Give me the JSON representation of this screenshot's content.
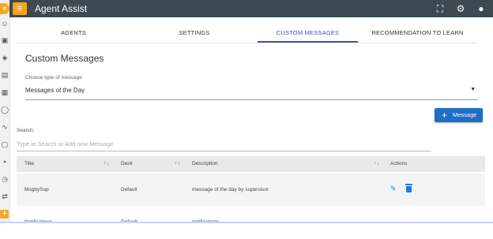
{
  "app": {
    "title": "Agent Assist",
    "accent": "#f5a623",
    "topbar_color": "#3c4a51",
    "primary": "#1f6fc6"
  },
  "header_icons": [
    "fullscreen-icon",
    "gear-icon",
    "account-icon"
  ],
  "sidebar_icons": [
    "smiley-icon",
    "contact-card-icon",
    "paint-bucket-icon",
    "chat-icon",
    "calendar-icon",
    "help-circle-icon",
    "activity-icon",
    "clipboard-icon",
    "grid-icon",
    "clock-icon",
    "translate-icon",
    "add-icon"
  ],
  "tabs": [
    {
      "label": "AGENTS",
      "active": false
    },
    {
      "label": "SETTINGS",
      "active": false
    },
    {
      "label": "CUSTOM MESSAGES",
      "active": true
    },
    {
      "label": "RECOMMENDATION TO LEARN",
      "active": false
    }
  ],
  "page": {
    "title": "Custom Messages",
    "type_label": "Choose type of message",
    "type_value": "Messages of the Day",
    "add_button": "Message",
    "search_label": "Search:",
    "search_placeholder": "Type to Search or Add new Message"
  },
  "table": {
    "columns": [
      "Title",
      "Desk",
      "Description",
      "Actions"
    ],
    "rows": [
      {
        "title": "MsgbySup",
        "desk": "Default",
        "description": "message of the day by supervisor"
      },
      {
        "title": "Notifications",
        "desk": "Default",
        "description": "notifications"
      }
    ]
  }
}
